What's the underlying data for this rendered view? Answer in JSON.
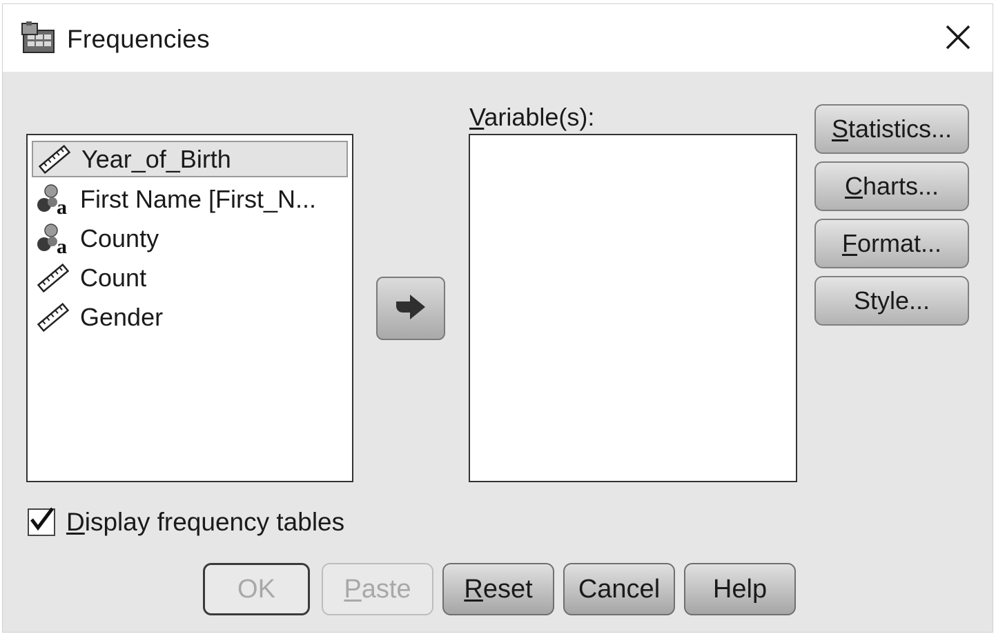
{
  "window": {
    "title": "Frequencies"
  },
  "source_list": {
    "items": [
      {
        "label": "Year_of_Birth",
        "icon": "scale-ruler-icon",
        "selected": true
      },
      {
        "label": "First Name [First_N...",
        "icon": "nominal-string-icon",
        "selected": false
      },
      {
        "label": "County",
        "icon": "nominal-string-icon",
        "selected": false
      },
      {
        "label": "Count",
        "icon": "scale-ruler-icon",
        "selected": false
      },
      {
        "label": "Gender",
        "icon": "scale-ruler-icon",
        "selected": false
      }
    ]
  },
  "target": {
    "label_mnemonic": "V",
    "label_rest": "ariable(s):",
    "items": []
  },
  "side_buttons": [
    {
      "mnemonic": "S",
      "rest": "tatistics..."
    },
    {
      "mnemonic": "C",
      "rest": "harts..."
    },
    {
      "mnemonic": "F",
      "rest": "ormat..."
    },
    {
      "mnemonic": "",
      "rest": "Style..."
    }
  ],
  "display_tables": {
    "mnemonic": "D",
    "rest": "isplay frequency tables",
    "checked": true
  },
  "bottom_buttons": [
    {
      "mnemonic": "",
      "rest": "OK",
      "enabled": false
    },
    {
      "mnemonic": "P",
      "rest": "aste",
      "enabled": false
    },
    {
      "mnemonic": "R",
      "rest": "eset",
      "enabled": true
    },
    {
      "mnemonic": "",
      "rest": "Cancel",
      "enabled": true
    },
    {
      "mnemonic": "",
      "rest": "Help",
      "enabled": true
    }
  ]
}
